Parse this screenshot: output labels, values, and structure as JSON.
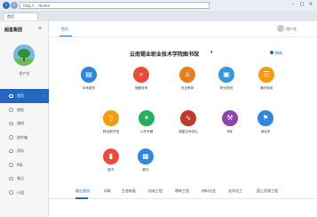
{
  "browser": {
    "address": "http://... /home",
    "tab_title": "首页",
    "back_icon": "back-icon",
    "forward_icon": "forward-icon"
  },
  "sidebar": {
    "brand": "超星集团",
    "username": "用户名",
    "items": [
      {
        "label": "首页",
        "active": true
      },
      {
        "label": "课程",
        "active": false
      },
      {
        "label": "通知",
        "active": false
      },
      {
        "label": "收件箱",
        "active": false
      },
      {
        "label": "资料",
        "active": false
      },
      {
        "label": "PBL",
        "active": false
      },
      {
        "label": "笔记",
        "active": false
      },
      {
        "label": "小组",
        "active": false
      }
    ]
  },
  "topbar": {
    "home_label": "首页",
    "user_label": "用户名"
  },
  "main": {
    "library_title": "云南锡业职业技术学院图书馆",
    "refresh_label": "刷新",
    "tiles": [
      {
        "label": "本地服务",
        "icon": "book-icon",
        "color": "#2e86de"
      },
      {
        "label": "馆藏查询",
        "icon": "search-icon",
        "color": "#e74c3c"
      },
      {
        "label": "安全教育",
        "icon": "house-icon",
        "color": "#e67e22"
      },
      {
        "label": "职业规划",
        "icon": "briefcase-icon",
        "color": "#3498db"
      },
      {
        "label": "通识阅读",
        "icon": "reading-icon",
        "color": "#f39c12"
      },
      {
        "label": "移动图书馆",
        "icon": "mobile-icon",
        "color": "#f39c12"
      },
      {
        "label": "公开专题",
        "icon": "topic-icon",
        "color": "#27ae60"
      },
      {
        "label": "超星名师讲坛",
        "icon": "lecture-icon",
        "color": "#c0392b"
      },
      {
        "label": "采矿",
        "icon": "mining-icon",
        "color": "#8e44ad"
      },
      {
        "label": "测绘学",
        "icon": "survey-icon",
        "color": "#2e86de"
      },
      {
        "label": "图书",
        "icon": "library-book-icon",
        "color": "#e74c3c"
      },
      {
        "label": "期刊",
        "icon": "journal-icon",
        "color": "#2e86de"
      }
    ],
    "bottom_tabs": [
      "最近使用",
      "训练",
      "生态恢复",
      "机电工程",
      "建筑工程",
      "材料冶金",
      "化学化工",
      "国土资源工程"
    ]
  }
}
